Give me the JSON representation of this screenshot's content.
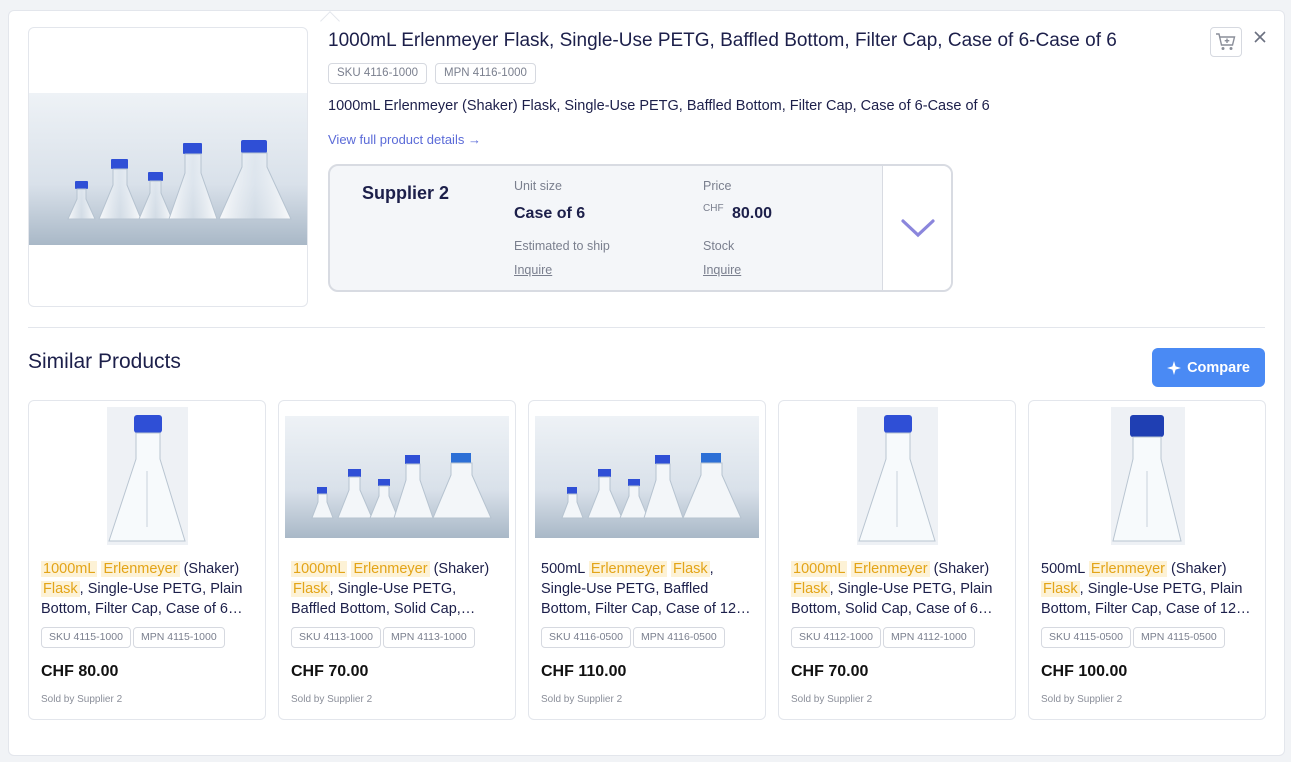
{
  "product": {
    "title": "1000mL Erlenmeyer Flask, Single-Use PETG, Baffled Bottom, Filter Cap, Case of 6-Case of 6",
    "sku": "SKU 4116-1000",
    "mpn": "MPN 4116-1000",
    "description": "1000mL Erlenmeyer (Shaker) Flask, Single-Use PETG, Baffled Bottom, Filter Cap, Case of 6-Case of 6",
    "view_link": "View full product details →",
    "image_icon": "flask-group-photo"
  },
  "supplier": {
    "name": "Supplier 2",
    "unit_size_label": "Unit size",
    "unit_size": "Case of 6",
    "price_label": "Price",
    "currency": "CHF",
    "price": "80.00",
    "ship_label": "Estimated to ship",
    "ship_value": "Inquire",
    "stock_label": "Stock",
    "stock_value": "Inquire"
  },
  "icons": {
    "cart": "cart-add-icon",
    "close": "close-icon",
    "expand": "chevron-down-icon",
    "sparkle": "sparkle-icon"
  },
  "similar": {
    "title": "Similar Products",
    "compare_label": "Compare",
    "items": [
      {
        "parts": [
          [
            "1000mL",
            true
          ],
          [
            " ",
            false
          ],
          [
            "Erlenmeyer",
            true
          ],
          [
            " (Shaker) ",
            false
          ],
          [
            "Flask",
            true
          ],
          [
            ", Single-Use PETG, Plain Bottom, Filter Cap, Case of 6…",
            false
          ]
        ],
        "sku": "SKU 4115-1000",
        "mpn": "MPN 4115-1000",
        "price": "CHF 80.00",
        "sold": "Sold by Supplier 2",
        "image": "single"
      },
      {
        "parts": [
          [
            "1000mL",
            true
          ],
          [
            " ",
            false
          ],
          [
            "Erlenmeyer",
            true
          ],
          [
            " (Shaker) ",
            false
          ],
          [
            "Flask",
            true
          ],
          [
            ", Single-Use PETG, Baffled Bottom, Solid Cap,…",
            false
          ]
        ],
        "sku": "SKU 4113-1000",
        "mpn": "MPN 4113-1000",
        "price": "CHF 70.00",
        "sold": "Sold by Supplier 2",
        "image": "group"
      },
      {
        "parts": [
          [
            "500mL ",
            false
          ],
          [
            "Erlenmeyer",
            true
          ],
          [
            " ",
            false
          ],
          [
            "Flask",
            true
          ],
          [
            ", Single-Use PETG, Baffled Bottom, Filter Cap, Case of 12…",
            false
          ]
        ],
        "sku": "SKU 4116-0500",
        "mpn": "MPN 4116-0500",
        "price": "CHF 110.00",
        "sold": "Sold by Supplier 2",
        "image": "group"
      },
      {
        "parts": [
          [
            "1000mL",
            true
          ],
          [
            " ",
            false
          ],
          [
            "Erlenmeyer",
            true
          ],
          [
            " (Shaker) ",
            false
          ],
          [
            "Flask",
            true
          ],
          [
            ", Single-Use PETG, Plain Bottom, Solid Cap, Case of 6…",
            false
          ]
        ],
        "sku": "SKU 4112-1000",
        "mpn": "MPN 4112-1000",
        "price": "CHF 70.00",
        "sold": "Sold by Supplier 2",
        "image": "single"
      },
      {
        "parts": [
          [
            "500mL ",
            false
          ],
          [
            "Erlenmeyer",
            true
          ],
          [
            " (Shaker) ",
            false
          ],
          [
            "Flask",
            true
          ],
          [
            ", Single-Use PETG, Plain Bottom, Filter Cap, Case of 12…",
            false
          ]
        ],
        "sku": "SKU 4115-0500",
        "mpn": "MPN 4115-0500",
        "price": "CHF 100.00",
        "sold": "Sold by Supplier 2",
        "image": "single-dark"
      }
    ]
  },
  "colors": {
    "accent": "#4a8af4",
    "highlight_text": "#e3a418",
    "highlight_bg": "#fdf2d6",
    "link": "#5b6bd8",
    "cap_blue": "#2f4fd6"
  }
}
